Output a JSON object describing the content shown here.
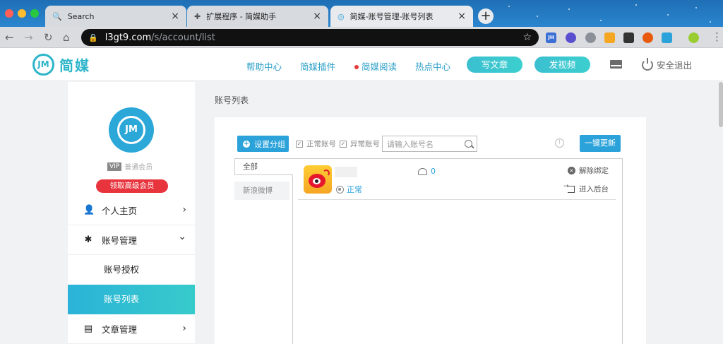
{
  "browser": {
    "tabs": [
      {
        "title": "Search",
        "icon": "search-icon",
        "active": false
      },
      {
        "title": "扩展程序 - 简媒助手",
        "icon": "puzzle-icon",
        "active": false
      },
      {
        "title": "简媒-账号管理-账号列表",
        "icon": "globe-icon",
        "active": true
      }
    ],
    "new_tab": "+",
    "url_host": "l3gt9.com",
    "url_path": "/s/account/list",
    "extensions": [
      {
        "label": "JH",
        "color": "#3b6fd6"
      },
      {
        "label": "",
        "color": "#5a4fcf"
      },
      {
        "label": "",
        "color": "#8a8f98"
      },
      {
        "label": "",
        "color": "#f5a623"
      },
      {
        "label": "",
        "color": "#333333"
      },
      {
        "label": "",
        "color": "#e8590c"
      },
      {
        "label": "",
        "color": "#2ba2da"
      }
    ]
  },
  "header": {
    "logo_text": "简媒",
    "logo_mark": "JM",
    "nav": [
      "帮助中心",
      "简媒插件",
      "简媒阅读",
      "热点中心"
    ],
    "write_button": "写文章",
    "video_button": "发视频",
    "logout": "安全退出",
    "accent": "#2db5c9"
  },
  "sidebar": {
    "avatar_mark": "JM",
    "vip_badge": "VIP",
    "member_type": "普通会员",
    "upgrade_button": "领取高级会员",
    "menu": [
      {
        "label": "个人主页",
        "icon": "user-icon",
        "chevron": "›"
      },
      {
        "label": "账号管理",
        "icon": "asterisk-icon",
        "chevron": "⌄"
      }
    ],
    "submenu": [
      {
        "label": "账号授权",
        "active": false
      },
      {
        "label": "账号列表",
        "active": true
      }
    ],
    "menu_bottom": {
      "label": "文章管理",
      "icon": "document-icon",
      "chevron": "›"
    }
  },
  "main": {
    "page_title": "账号列表",
    "group_button": "设置分组",
    "filters": [
      {
        "label": "正常账号",
        "checked": true
      },
      {
        "label": "异常账号",
        "checked": true
      }
    ],
    "search_placeholder": "请输入账号名",
    "refresh_button": "一键更新",
    "groups": [
      "全部",
      "新浪微博"
    ],
    "account": {
      "platform_icon": "weibo-icon",
      "status": "正常",
      "fans": "0",
      "unbind": "解除绑定",
      "enter_backend": "进入后台"
    }
  }
}
